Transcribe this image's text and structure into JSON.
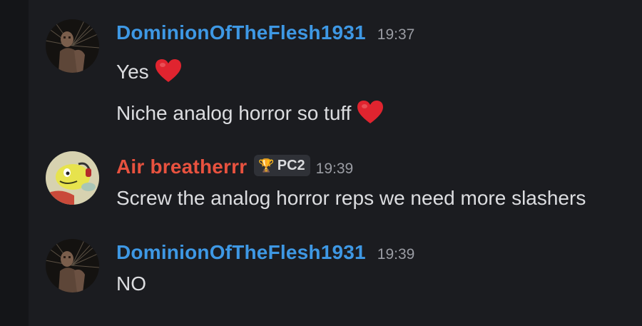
{
  "messages": [
    {
      "username": "DominionOfTheFlesh1931",
      "timestamp": "19:37",
      "lines": [
        "Yes",
        "Niche analog horror so tuff"
      ],
      "emoji": [
        "heart-emoji",
        "heart-emoji"
      ],
      "name_color": "#3e98e4"
    },
    {
      "username": "Air breatherrr",
      "timestamp": "19:39",
      "tag": {
        "icon": "trophy-icon",
        "label": "PC2"
      },
      "lines": [
        "Screw the analog horror reps we need more slashers"
      ],
      "name_color": "#e8523f"
    },
    {
      "username": "DominionOfTheFlesh1931",
      "timestamp": "19:39",
      "lines": [
        "NO"
      ],
      "name_color": "#3e98e4"
    }
  ],
  "colors": {
    "background": "#1b1c20",
    "gutter": "#141518",
    "message_text": "#dcdde0",
    "timestamp": "#9a9ca3",
    "heart": "#e0242f"
  }
}
